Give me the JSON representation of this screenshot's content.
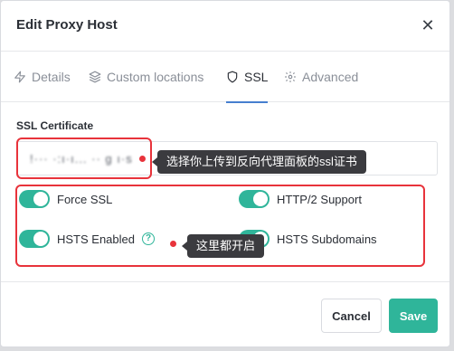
{
  "modal": {
    "title": "Edit Proxy Host",
    "close_glyph": "✕"
  },
  "tabs": [
    {
      "label": "Details",
      "icon": "zap-icon"
    },
    {
      "label": "Custom locations",
      "icon": "layers-icon"
    },
    {
      "label": "SSL",
      "icon": "shield-icon",
      "active": true
    },
    {
      "label": "Advanced",
      "icon": "gear-icon"
    }
  ],
  "ssl": {
    "certificate_label": "SSL Certificate",
    "certificate_value": "!··· ·:ı·ı...  ·· g ı·s",
    "options": {
      "force_ssl": {
        "label": "Force SSL",
        "enabled": true
      },
      "http2": {
        "label": "HTTP/2 Support",
        "enabled": true
      },
      "hsts_enabled": {
        "label": "HSTS Enabled",
        "enabled": true,
        "help": "?"
      },
      "hsts_subdomains": {
        "label": "HSTS Subdomains",
        "enabled": true
      }
    }
  },
  "annotations": {
    "cert_tip": "选择你上传到反向代理面板的ssl证书",
    "options_tip": "这里都开启",
    "highlight_color": "#e8333b"
  },
  "footer": {
    "cancel_label": "Cancel",
    "save_label": "Save"
  },
  "colors": {
    "accent": "#2fb59a",
    "tab_active": "#467fcf"
  }
}
